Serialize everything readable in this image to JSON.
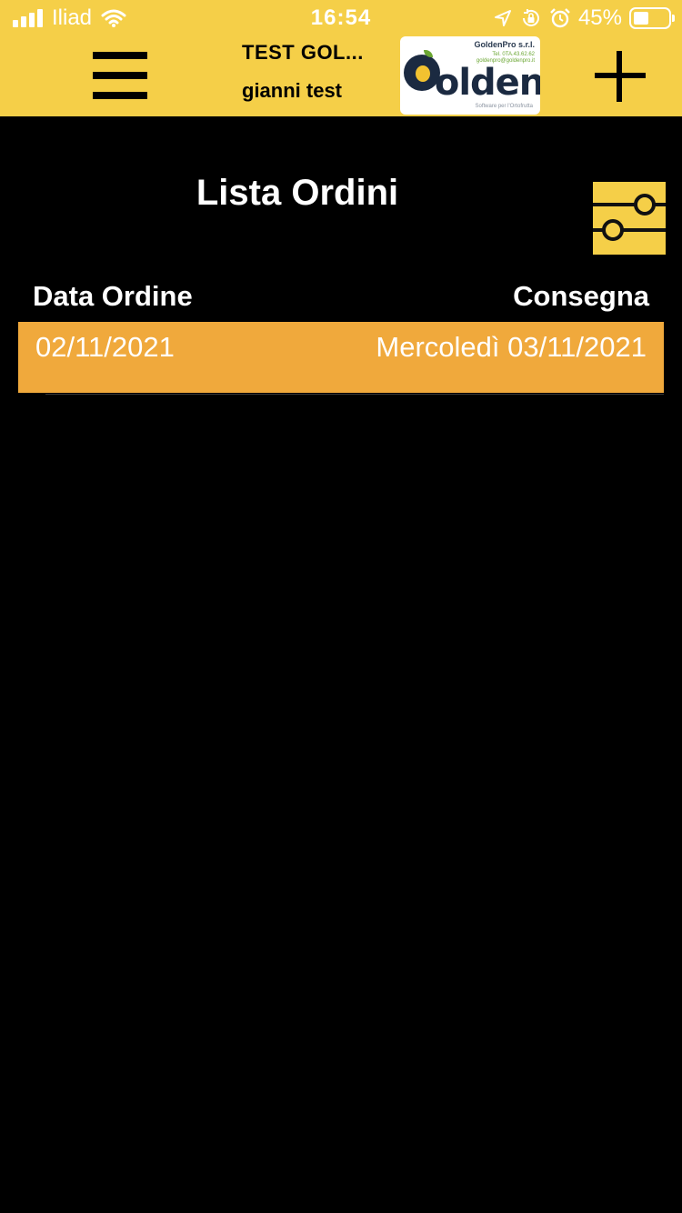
{
  "status_bar": {
    "carrier": "Iliad",
    "time": "16:54",
    "battery_percent": "45%",
    "battery_level": 0.45,
    "icons": [
      "signal-icon",
      "wifi-icon",
      "location-icon",
      "rotation-lock-icon",
      "alarm-icon",
      "battery-icon"
    ]
  },
  "header": {
    "company": "TEST GOL...",
    "user": "gianni test",
    "logo": {
      "brand": "GoldenPro s.r.l.",
      "phone": "Tel. 0TA.43.62.62",
      "email": "goldenpro@goldenpro.it",
      "wordmark": "Golden",
      "tagline": "Software per l'Ortofrutta"
    },
    "menu_icon": "hamburger-icon",
    "add_icon": "plus-icon"
  },
  "page": {
    "title": "Lista Ordini",
    "filter_icon": "filter-sliders-icon"
  },
  "table": {
    "columns": [
      "Data Ordine",
      "Consegna"
    ],
    "rows": [
      {
        "order_date": "02/11/2021",
        "delivery": "Mercoledì 03/11/2021"
      }
    ]
  },
  "colors": {
    "header_bg": "#f5cf48",
    "row_bg": "#f0a93c",
    "page_bg": "#000000",
    "text": "#ffffff"
  }
}
